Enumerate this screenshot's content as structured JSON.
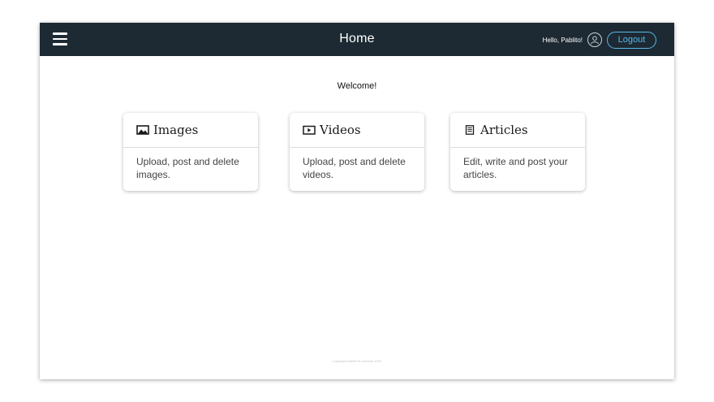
{
  "header": {
    "title": "Home",
    "greeting": "Hello, Pablito!",
    "logout_label": "Logout"
  },
  "main": {
    "welcome": "Welcome!",
    "cards": [
      {
        "title": "Images",
        "description": "Upload, post and delete images.",
        "icon": "image-icon"
      },
      {
        "title": "Videos",
        "description": "Upload, post and delete videos.",
        "icon": "video-icon"
      },
      {
        "title": "Articles",
        "description": "Edit, write and post your articles.",
        "icon": "article-icon"
      }
    ]
  },
  "footer": {
    "text": "Copyright Daniel M Cardona 2020"
  },
  "colors": {
    "topbar": "#1d2a33",
    "accent": "#57b7ea"
  }
}
